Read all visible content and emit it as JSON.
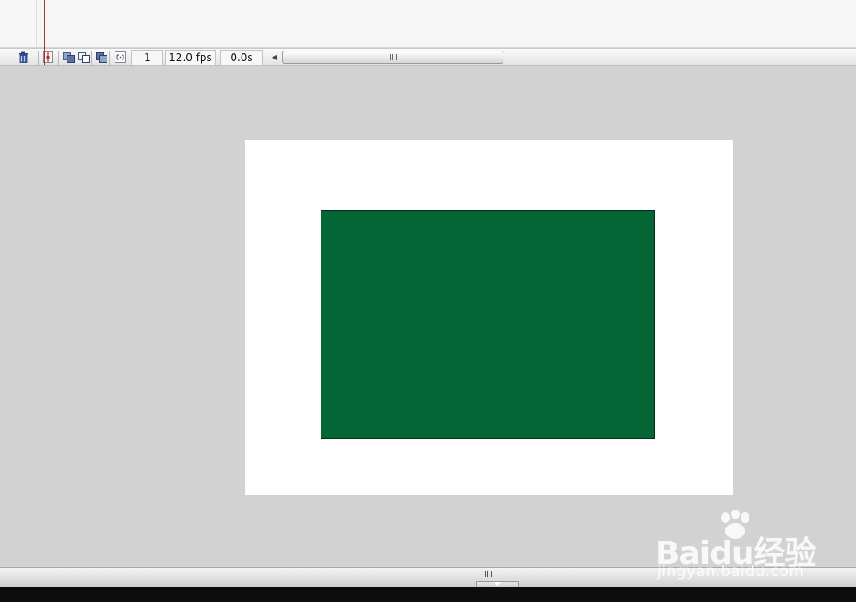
{
  "statusbar": {
    "current_frame": "1",
    "frame_rate": "12.0 fps",
    "elapsed_time": "0.0s",
    "icons": [
      "trash-icon",
      "center-frame-icon",
      "onion-skin-icon",
      "onion-skin-outlines-icon",
      "edit-multiple-frames-icon",
      "modify-onion-markers-icon"
    ]
  },
  "stage": {
    "background_color": "#ffffff",
    "shape_color": "#046635",
    "shape_border_color": "#0b2a1b"
  },
  "pasteboard_color": "#d2d2d2",
  "watermark": {
    "logo": "Baidu经验",
    "url": "jingyan.baidu.com"
  }
}
